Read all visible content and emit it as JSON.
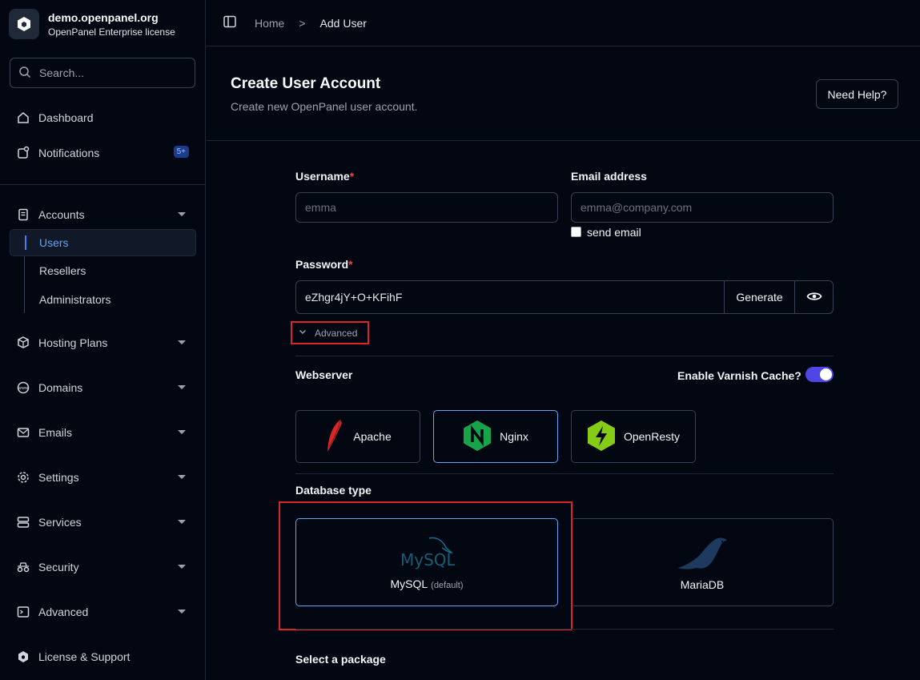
{
  "brand": {
    "title": "demo.openpanel.org",
    "subtitle": "OpenPanel Enterprise license"
  },
  "search": {
    "placeholder": "Search..."
  },
  "nav": {
    "dashboard": "Dashboard",
    "notifications": "Notifications",
    "notifications_badge": "5+",
    "accounts": "Accounts",
    "accounts_sub": {
      "users": "Users",
      "resellers": "Resellers",
      "administrators": "Administrators"
    },
    "hosting_plans": "Hosting Plans",
    "domains": "Domains",
    "emails": "Emails",
    "settings": "Settings",
    "services": "Services",
    "security": "Security",
    "advanced": "Advanced",
    "license": "License & Support"
  },
  "breadcrumb": {
    "home": "Home",
    "sep": ">",
    "current": "Add User"
  },
  "header": {
    "title": "Create User Account",
    "subtitle": "Create new OpenPanel user account.",
    "help_button": "Need Help?"
  },
  "form": {
    "username_label": "Username",
    "username_required": "*",
    "username_placeholder": "emma",
    "email_label": "Email address",
    "email_placeholder": "emma@company.com",
    "send_email_label": "send email",
    "password_label": "Password",
    "password_required": "*",
    "password_value": "eZhgr4jY+O+KFihF",
    "generate_button": "Generate",
    "advanced_toggle": "Advanced"
  },
  "webserver": {
    "title": "Webserver",
    "varnish_label": "Enable Varnish Cache?",
    "options": [
      "Apache",
      "Nginx",
      "OpenResty"
    ],
    "selected": "Nginx"
  },
  "database": {
    "title": "Database type",
    "mysql_label": "MySQL",
    "mysql_default": "(default)",
    "mysql_logo_text": "MySQL",
    "mariadb_label": "MariaDB"
  },
  "package": {
    "title": "Select a package"
  },
  "colors": {
    "accent": "#4f46e5",
    "link": "#60a5fa",
    "required": "#ef4444",
    "highlight": "#dc2626"
  }
}
